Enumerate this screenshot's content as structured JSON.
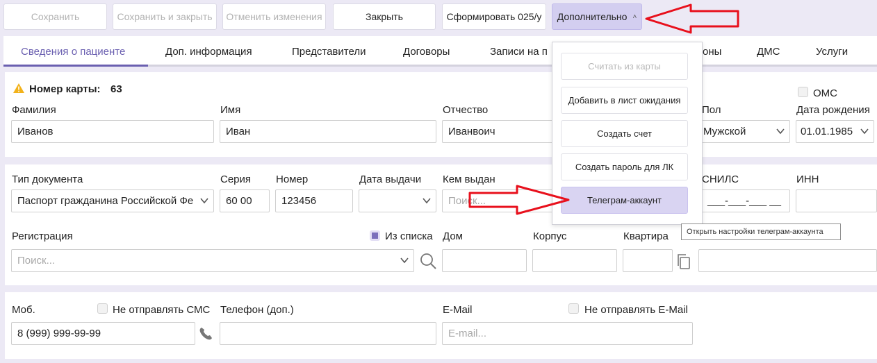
{
  "toolbar": {
    "save": "Сохранить",
    "save_close": "Сохранить и закрыть",
    "cancel_changes": "Отменить изменения",
    "close": "Закрыть",
    "form_025": "Сформировать 025/у",
    "more": "Дополнительно"
  },
  "tabs": [
    "Сведения о пациенте",
    "Доп. информация",
    "Представители",
    "Договоры",
    "Записи на п",
    "оны",
    "ДМС",
    "Услуги"
  ],
  "patient": {
    "card_label": "Номер карты:",
    "card_number": "63",
    "oms_label": "ОМС",
    "surname_label": "Фамилия",
    "surname": "Иванов",
    "name_label": "Имя",
    "name": "Иван",
    "patronymic_label": "Отчество",
    "patronymic": "Иванвоич",
    "sex_label": "Пол",
    "sex": "Мужской",
    "birth_label": "Дата рождения",
    "birth": "01.01.1985"
  },
  "document": {
    "type_label": "Тип документа",
    "type": "Паспорт гражданина Российской Фе",
    "series_label": "Серия",
    "series": "60 00",
    "number_label": "Номер",
    "number": "123456",
    "issue_date_label": "Дата выдачи",
    "issued_by_label": "Кем выдан",
    "issued_by_placeholder": "Поиск...",
    "snils_label": "СНИЛС",
    "snils_mask": "___-___-___ __",
    "inn_label": "ИНН"
  },
  "address": {
    "registration_label": "Регистрация",
    "from_list_label": "Из списка",
    "search_placeholder": "Поиск...",
    "house_label": "Дом",
    "building_label": "Корпус",
    "apartment_label": "Квартира"
  },
  "contacts": {
    "mobile_label": "Моб.",
    "no_sms_label": "Не отправлять СМС",
    "mobile": "8 (999) 999-99-99",
    "phone_extra_label": "Телефон (доп.)",
    "email_label": "E-Mail",
    "email_placeholder": "E-mail...",
    "no_email_label": "Не отправлять E-Mail"
  },
  "dropdown": {
    "items": [
      "Считать из карты",
      "Добавить в лист ожидания",
      "Создать счет",
      "Создать пароль для ЛК",
      "Телеграм-аккаунт"
    ],
    "tooltip": "Открыть настройки телеграм-аккаунта"
  },
  "colors": {
    "accent": "#6a5fb0",
    "arrow": "#e8101c",
    "menu_highlight": "#d9d4f2",
    "warning": "#f2b21b"
  }
}
